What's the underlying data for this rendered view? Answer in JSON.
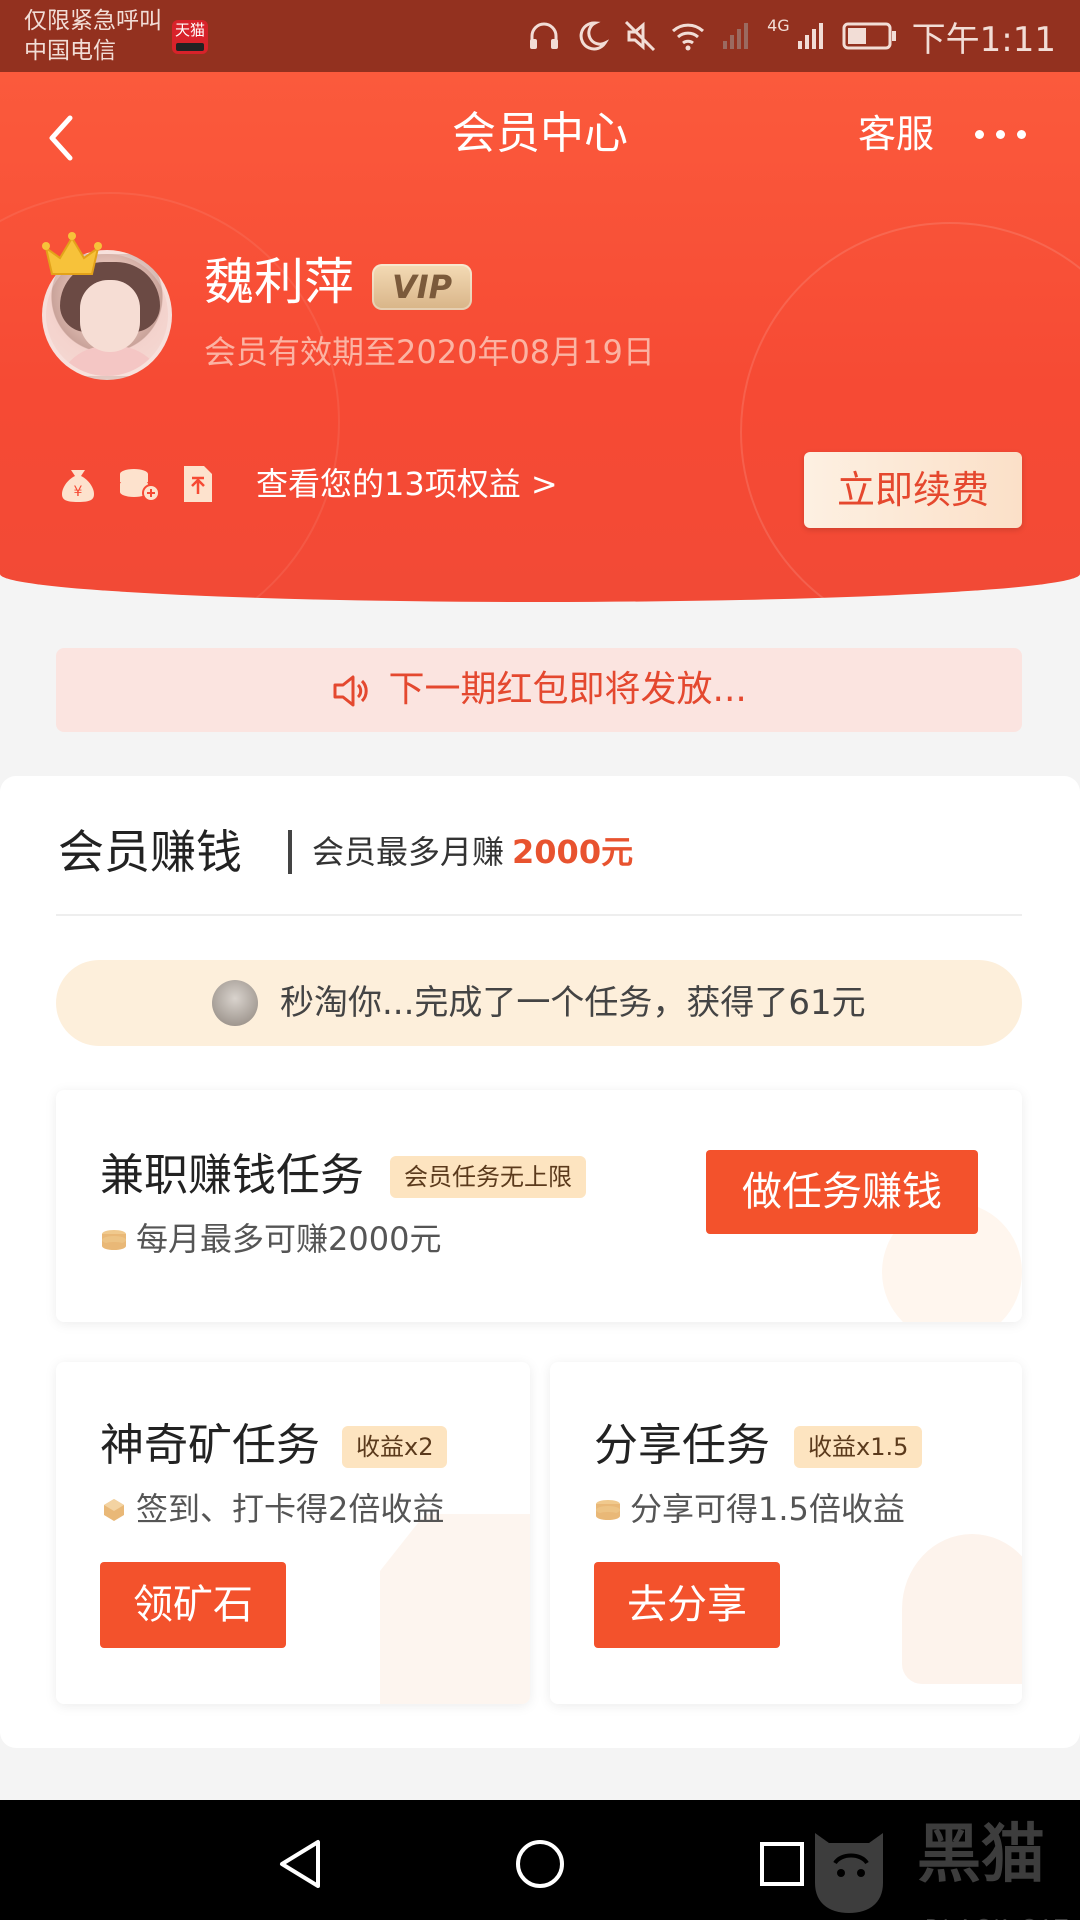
{
  "status_bar": {
    "line1": "仅限紧急呼叫",
    "line2": "中国电信",
    "app_icon_label": "天猫",
    "network": "4G",
    "time": "下午1:11"
  },
  "header": {
    "title": "会员中心",
    "service_label": "客服",
    "user_name": "魏利萍",
    "vip_label": "VIP",
    "expire_text": "会员有效期至2020年08月19日",
    "benefits_link": "查看您的13项权益 >",
    "renew_label": "立即续费"
  },
  "notice": {
    "text": "下一期红包即将发放..."
  },
  "earn_section": {
    "title": "会员赚钱",
    "subtitle": "会员最多月赚",
    "amount": "2000元",
    "ticker_text": "秒淘你...完成了一个任务，获得了61元",
    "tasks": [
      {
        "title": "兼职赚钱任务",
        "tag": "会员任务无上限",
        "desc": "每月最多可赚2000元",
        "button": "做任务赚钱"
      },
      {
        "title": "神奇矿任务",
        "tag": "收益x2",
        "desc": "签到、打卡得2倍收益",
        "button": "领矿石"
      },
      {
        "title": "分享任务",
        "tag": "收益x1.5",
        "desc": "分享可得1.5倍收益",
        "button": "去分享"
      }
    ]
  },
  "watermark": {
    "text": "黑猫",
    "sub": "BLACK CAT"
  },
  "colors": {
    "header_red": "#f64a34",
    "accent_orange": "#f3522c",
    "status_bar": "#93311f"
  }
}
